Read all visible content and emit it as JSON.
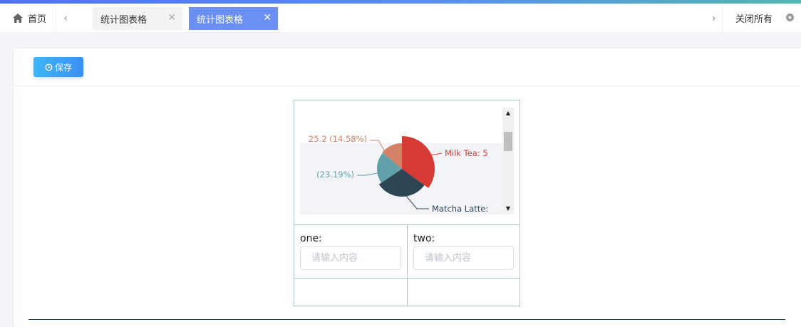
{
  "tabbar": {
    "home_label": "首页",
    "tabs": [
      {
        "label": "统计图表格",
        "active": false
      },
      {
        "label": "统计图表格",
        "active": true
      }
    ],
    "close_all_label": "关闭所有"
  },
  "toolbar": {
    "save_label": "保存"
  },
  "form": {
    "fields": [
      {
        "label": "one:",
        "placeholder": "请输入内容",
        "value": ""
      },
      {
        "label": "two:",
        "placeholder": "请输入内容",
        "value": ""
      }
    ]
  },
  "chart_data": {
    "type": "pie",
    "slices": [
      {
        "label": "Milk Tea: 5",
        "color": "#d63b36"
      },
      {
        "label": "Matcha Latte:",
        "color": "#2e4554"
      },
      {
        "label": "(23.19%)",
        "percent": 23.19,
        "color": "#61a0a8"
      },
      {
        "label": "25.2 (14.58%)",
        "value": 25.2,
        "percent": 14.58,
        "color": "#d48265"
      }
    ]
  },
  "colors": {
    "accent": "#6b8ff3",
    "save_button": "#3fb6f6"
  }
}
